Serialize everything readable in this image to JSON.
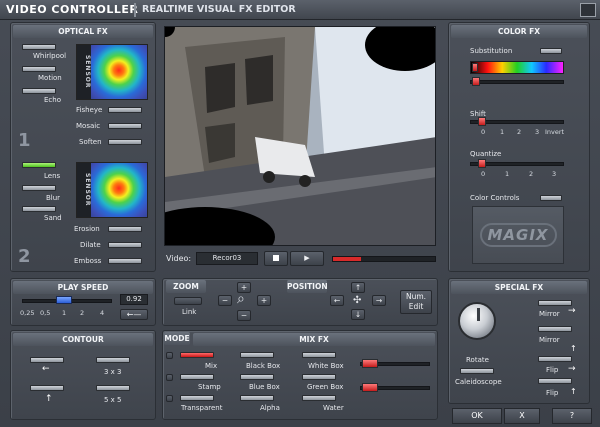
{
  "title": {
    "main": "VIDEO CONTROLLER",
    "sub": "REALTIME VISUAL FX EDITOR"
  },
  "optical": {
    "title": "OPTICAL FX",
    "sensor_label": "SENSOR",
    "left1": [
      "Whirlpool",
      "Motion",
      "Echo"
    ],
    "right1": [
      "Fisheye",
      "Mosaic",
      "Soften"
    ],
    "num1": "1",
    "left2": [
      "Lens",
      "Blur",
      "Sand"
    ],
    "right2": [
      "Erosion",
      "Dilate",
      "Emboss"
    ],
    "num2": "2"
  },
  "video": {
    "label": "Video:",
    "recorder": "Recor03"
  },
  "color": {
    "title": "COLOR FX",
    "substitution": "Substitution",
    "shift": "Shift",
    "shift_ticks": [
      "0",
      "1",
      "2",
      "3",
      "Invert"
    ],
    "quantize": "Quantize",
    "quantize_ticks": [
      "0",
      "1",
      "2",
      "3"
    ],
    "color_controls": "Color Controls",
    "logo": "MAGIX"
  },
  "play": {
    "title": "PLAY SPEED",
    "ticks": [
      "0,25",
      "0,5",
      "1",
      "2",
      "4"
    ],
    "value": "0.92"
  },
  "zoom": {
    "title": "ZOOM",
    "link": "Link"
  },
  "position": {
    "title": "POSITION",
    "num_edit": "Num. Edit"
  },
  "contour": {
    "title": "CONTOUR",
    "c1": "3 x 3",
    "c2": "5 x 5"
  },
  "mix": {
    "title": "MIX FX",
    "mode": "MODE",
    "col1": [
      "Mix",
      "Stamp",
      "Transparent"
    ],
    "col2": [
      "Black Box",
      "Blue Box",
      "Alpha"
    ],
    "col3": [
      "White Box",
      "Green Box",
      "Water"
    ]
  },
  "special": {
    "title": "SPECIAL FX",
    "rotate": "Rotate",
    "caleidoscope": "Caleidoscope",
    "mirror1": "Mirror",
    "mirror2": "Mirror",
    "flip1": "Flip",
    "flip2": "Flip"
  },
  "footer": {
    "ok": "OK",
    "x": "X",
    "help": "?"
  }
}
